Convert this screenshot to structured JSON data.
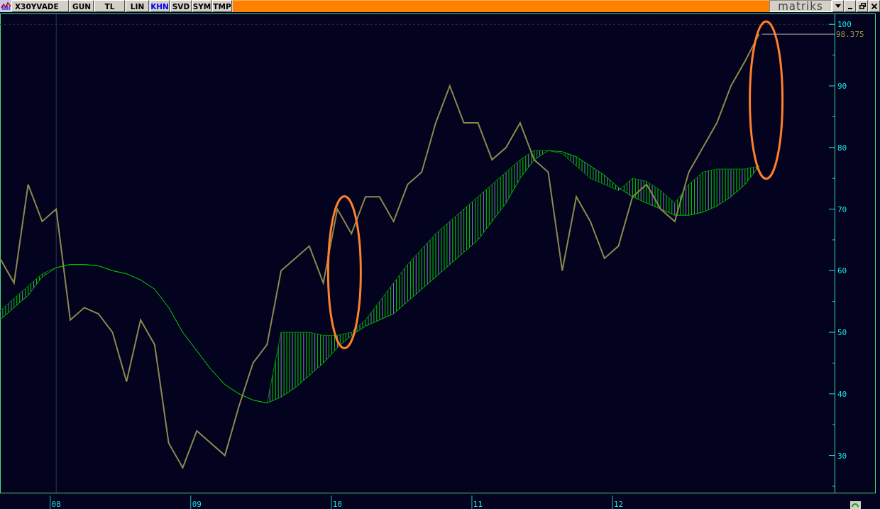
{
  "toolbar": {
    "symbol": "X30YVADE",
    "tabs": [
      {
        "label": "GUN",
        "selected": false
      },
      {
        "label": "TL",
        "selected": false
      },
      {
        "label": "LIN",
        "selected": false
      },
      {
        "label": "KHN",
        "selected": true
      },
      {
        "label": "SVD",
        "selected": false
      },
      {
        "label": "SYM",
        "selected": false
      },
      {
        "label": "TMP",
        "selected": false
      }
    ],
    "logo": "matriks"
  },
  "chart": {
    "last_price_label": "98.375",
    "chart_data": {
      "type": "line",
      "x": [
        7.6,
        7.7,
        7.8,
        7.9,
        8.0,
        8.1,
        8.2,
        8.3,
        8.4,
        8.5,
        8.6,
        8.7,
        8.8,
        8.9,
        9.0,
        9.1,
        9.2,
        9.3,
        9.4,
        9.5,
        9.6,
        9.7,
        9.8,
        9.9,
        10.0,
        10.1,
        10.2,
        10.3,
        10.4,
        10.5,
        10.6,
        10.7,
        10.8,
        10.9,
        11.0,
        11.1,
        11.2,
        11.3,
        11.4,
        11.5,
        11.6,
        11.7,
        11.8,
        11.9,
        12.0,
        12.1,
        12.2,
        12.3,
        12.4,
        12.5,
        12.6,
        12.7,
        12.8,
        12.9,
        13.0
      ],
      "series": [
        {
          "color": "#8c8a4c",
          "values": [
            62,
            58,
            74,
            68,
            70,
            52,
            54,
            53,
            50,
            42,
            52,
            48,
            32,
            28,
            34,
            32,
            30,
            38,
            45,
            48,
            60,
            62,
            64,
            58,
            70,
            66,
            72,
            72,
            68,
            74,
            76,
            84,
            90,
            84,
            84,
            78,
            80,
            84,
            78,
            76,
            60,
            72,
            68,
            62,
            64,
            72,
            74,
            70,
            68,
            76,
            80,
            84,
            90,
            94,
            98.4
          ]
        },
        {
          "color": "#00c000",
          "values": [
            52,
            54,
            56,
            59,
            60.5,
            61,
            61,
            60.8,
            60,
            59.5,
            58.5,
            57,
            54,
            50,
            47,
            44,
            41.5,
            40,
            39,
            38.5,
            39.5,
            41,
            43,
            45,
            47.5,
            49.5,
            51,
            52,
            53,
            55,
            57,
            59,
            61,
            63,
            65,
            68,
            71,
            75,
            78,
            79.5,
            79.3,
            78.5,
            77,
            75.5,
            73.5,
            72,
            71,
            70,
            69,
            69,
            69.5,
            70.5,
            72,
            74,
            77
          ]
        },
        {
          "color": "#008800",
          "values": [
            53.5,
            55.5,
            57.5,
            59.5,
            60.5,
            61,
            61,
            60.8,
            60,
            59.5,
            58.5,
            57,
            54,
            50,
            47,
            44,
            41.5,
            40,
            39,
            38.5,
            50,
            50,
            50,
            49.5,
            49.5,
            50,
            52,
            55,
            58,
            61,
            63.5,
            66,
            68,
            70,
            72,
            74,
            76,
            78,
            79.5,
            79.5,
            79,
            77,
            75,
            74,
            73,
            75,
            74.5,
            73,
            71,
            74,
            76,
            76.5,
            76.5,
            76.5,
            77
          ]
        }
      ],
      "xlim": [
        7.6,
        13.83
      ],
      "ylim": [
        23.9,
        101.7
      ],
      "xticks": [
        {
          "value": 8,
          "label": "08"
        },
        {
          "value": 9,
          "label": "09"
        },
        {
          "value": 10,
          "label": "10"
        },
        {
          "value": 11,
          "label": "11"
        },
        {
          "value": 12,
          "label": "12"
        }
      ],
      "yticks": [
        30,
        40,
        50,
        60,
        70,
        80,
        90,
        100
      ],
      "ref_lines": [
        {
          "axis": "x",
          "value": 8
        },
        {
          "axis": "y",
          "value": 100
        }
      ]
    }
  }
}
